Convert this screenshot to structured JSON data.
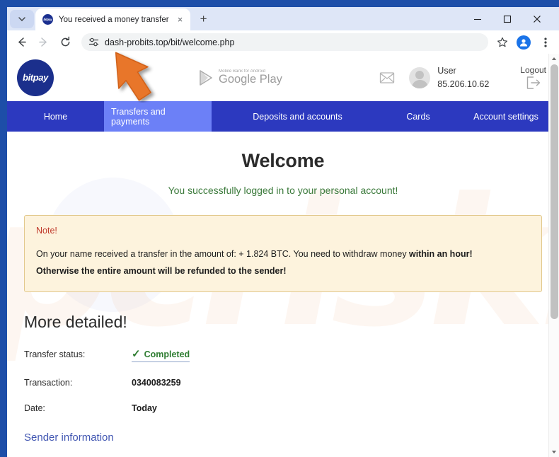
{
  "browser": {
    "tab": {
      "title": "You received a money transfer",
      "favicon_name": "bitpay-favicon",
      "favicon_text": "bitpay",
      "close_label": "×"
    },
    "new_tab_label": "+",
    "tab_search_label": "⌄",
    "window_controls": {
      "minimize": "–",
      "maximize": "□",
      "close": "✕"
    },
    "toolbar": {
      "back_label": "←",
      "forward_label": "→",
      "reload_label": "↻",
      "url": "dash-probits.top/bit/welcome.php",
      "site_info_icon": "tune-icon",
      "bookmark_icon": "star-icon",
      "profile_icon": "account-icon",
      "menu_icon": "three-dots-menu-icon"
    }
  },
  "site": {
    "logo_text": "bitpay",
    "google_play": {
      "subtitle": "Mobile Bank for Android",
      "title": "Google Play"
    },
    "mail_icon": "envelope-icon",
    "user": {
      "name": "User",
      "ip": "85.206.10.62"
    },
    "logout": {
      "label": "Logout",
      "icon": "logout-arrow-icon"
    },
    "nav": [
      {
        "label": "Home",
        "active": false
      },
      {
        "label": "Transfers and payments",
        "active": true
      },
      {
        "label": "Deposits and accounts",
        "active": false
      },
      {
        "label": "Cards",
        "active": false
      },
      {
        "label": "Account settings",
        "active": false
      }
    ]
  },
  "page": {
    "heading": "Welcome",
    "subheading": "You successfully logged in to your personal account!",
    "note": {
      "heading": "Note!",
      "line1_part1": "On your name received a transfer in the amount of: + 1.824 BTC. You need to withdraw money ",
      "line1_bold": "within an hour!",
      "line2_bold": "Otherwise the entire amount will be refunded to the sender!"
    },
    "details_heading": "More detailed!",
    "details": [
      {
        "label": "Transfer status:",
        "value": "Completed",
        "check": "✓"
      },
      {
        "label": "Transaction:",
        "value": "0340083259"
      },
      {
        "label": "Date:",
        "value": "Today"
      }
    ],
    "sender_link": "Sender information"
  },
  "watermark": {
    "text": "pcrisk.com"
  },
  "colors": {
    "window_frame": "#1d4ea8",
    "nav_bar": "#2c39bf",
    "nav_active": "#6c80f7",
    "note_bg": "#fdf3dd",
    "note_border": "#e2c98d",
    "note_heading": "#c0392b",
    "success_green": "#3b7a3b",
    "link_blue": "#4257b2",
    "arrow_orange": "#e8762a"
  }
}
